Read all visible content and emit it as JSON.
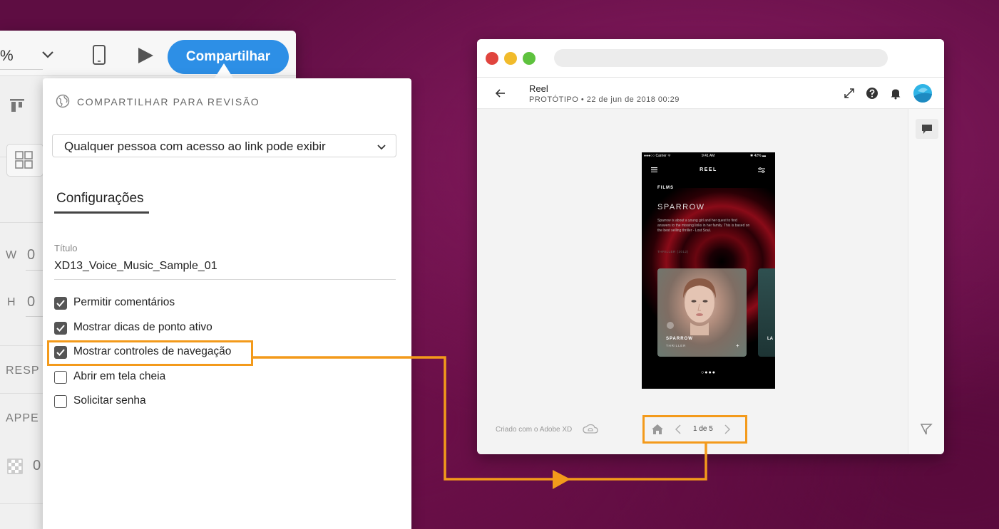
{
  "colors": {
    "highlight": "#f39a1b",
    "share_button": "#2d8fe6",
    "background": "#5e0d42"
  },
  "xd_toolbar": {
    "zoom_value": "%",
    "share_label": "Compartilhar"
  },
  "xd_sidebar": {
    "w_label": "W",
    "w_value": "0",
    "h_label": "H",
    "h_value": "0",
    "responsive_label": "RESP",
    "appearance_label": "APPE",
    "opacity_value": "0"
  },
  "share_popover": {
    "header": "COMPARTILHAR PARA REVISÃO",
    "access_selected": "Qualquer pessoa com acesso ao link pode exibir",
    "settings_tab": "Configurações",
    "title_label": "Título",
    "title_value": "XD13_Voice_Music_Sample_01",
    "options": [
      {
        "label": "Permitir comentários",
        "checked": true
      },
      {
        "label": "Mostrar dicas de ponto ativo",
        "checked": true
      },
      {
        "label": "Mostrar controles de navegação",
        "checked": true
      },
      {
        "label": "Abrir em tela cheia",
        "checked": false
      },
      {
        "label": "Solicitar senha",
        "checked": false
      }
    ]
  },
  "browser": {
    "project_name": "Reel",
    "project_meta": "PROTÓTIPO  •  22 de jun de 2018 00:29",
    "made_with": "Criado com o Adobe XD",
    "page_indicator": "1 de 5"
  },
  "phone": {
    "status_carrier": "●●●○○ Carrier ᯤ",
    "status_time": "9:41 AM",
    "status_battery": "✱ 42% ▬",
    "brand": "REEL",
    "section": "FILMS",
    "title": "SPARROW",
    "description": "Sparrow is about a young girl and her quest to find answers to the missing links in her family. This is based on the best selling thriller - Lost Soul.",
    "genre_line": "THRILLER (2012)",
    "card_name": "SPARROW",
    "card_genre": "THRILLER",
    "card_plus": "+",
    "card2_name": "LA",
    "pager": "○●●●"
  }
}
